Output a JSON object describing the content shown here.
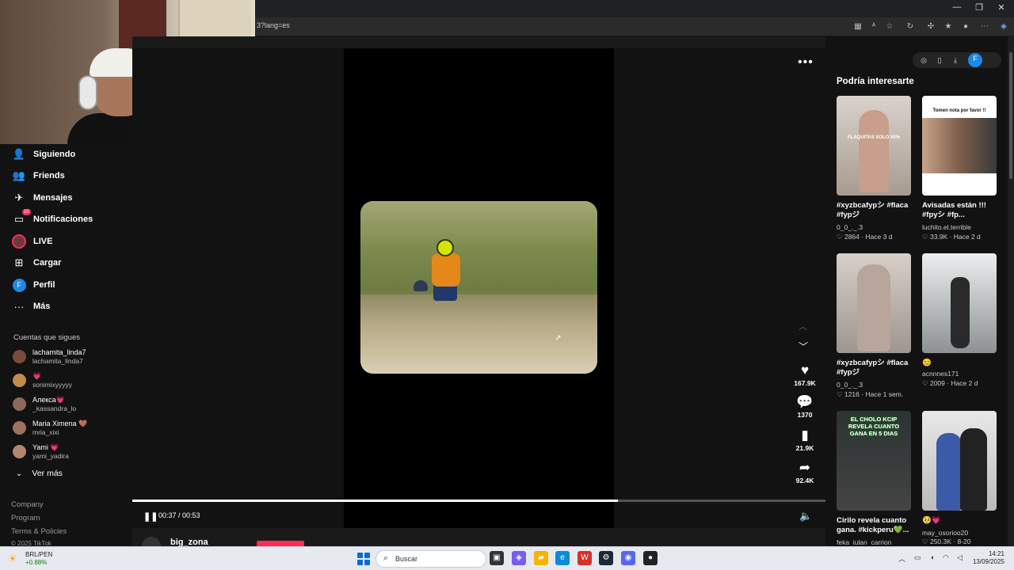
{
  "browser": {
    "url": "3?lang=es",
    "window_controls": [
      "—",
      "❐",
      "✕"
    ]
  },
  "sidebar": {
    "items": [
      {
        "label": "Siguiendo",
        "icon": "following-icon"
      },
      {
        "label": "Friends",
        "icon": "friends-icon"
      },
      {
        "label": "Mensajes",
        "icon": "messages-icon"
      },
      {
        "label": "Notificaciones",
        "icon": "notifications-icon",
        "badge": "10"
      },
      {
        "label": "LIVE",
        "icon": "live-icon"
      },
      {
        "label": "Cargar",
        "icon": "upload-icon"
      },
      {
        "label": "Perfil",
        "icon": "profile-icon",
        "avatar_letter": "F"
      },
      {
        "label": "Más",
        "icon": "more-icon"
      }
    ],
    "following_heading": "Cuentas que sigues",
    "accounts": [
      {
        "name": "lachamita_linda7",
        "handle": "lachamita_linda7",
        "color": "#7a4b3a"
      },
      {
        "name": "💗",
        "handle": "sonimixyyyyy",
        "color": "#c28b4b"
      },
      {
        "name": "Алекса💗",
        "handle": "_kassandra_lo",
        "color": "#8a6a5a"
      },
      {
        "name": "Maria Ximena 🤎",
        "handle": "mria_xixi",
        "color": "#a07060"
      },
      {
        "name": "Yami 💗",
        "handle": "yami_yadira",
        "color": "#b08870"
      }
    ],
    "see_more": "Ver más",
    "footer_links": [
      "Company",
      "Program",
      "Terms & Policies",
      "© 2025 TikTok"
    ]
  },
  "video": {
    "more": "•••",
    "likes": "167.9K",
    "comments": "1370",
    "saves": "21.9K",
    "shares": "92.4K",
    "time": "00:37 / 00:53",
    "progress": 0.7,
    "author": "big_zona"
  },
  "panel": {
    "title": "Podría interesarte",
    "cards": [
      {
        "thumb_text": "FLAQUITAS SOLO 50%",
        "caption": "#xyzbcafypシ #flaca #fypジ",
        "author": "0_0_._.3",
        "stats": "♡ 2864 · Hace 3 d"
      },
      {
        "thumb_text": "Tomen nota por favor !!",
        "caption": "Avisadas están !!! #fpyシ #fp...",
        "author": "luchito.el.terrible",
        "stats": "♡ 33.9K · Hace 2 d"
      },
      {
        "thumb_text": "",
        "caption": "#xyzbcafypシ #flaca #fypジ",
        "author": "0_0_._.3",
        "stats": "♡ 1216 · Hace 1 sem."
      },
      {
        "thumb_text": "",
        "caption": "😊",
        "author": "acnnnes171",
        "stats": "♡ 2009 · Hace 2 d"
      },
      {
        "thumb_text": "EL CHOLO KCIP REVELA CUANTO GANA EN 5 DIAS",
        "caption": "Cirilo revela cuanto gana. #kickperu💚...",
        "author": "feka_iulan_carrion",
        "stats": ""
      },
      {
        "thumb_text": "",
        "caption": "🥺💗",
        "author": "may_osorioo20",
        "stats": "♡ 250.3K · 8-20"
      }
    ]
  },
  "taskbar": {
    "ticker_symbol": "BRL/PEN",
    "ticker_change": "+0.88%",
    "search_placeholder": "Buscar",
    "time": "14:21",
    "date": "13/09/2025"
  },
  "colors": {
    "accent": "#fe2c55",
    "bg": "#121212",
    "taskbar": "#e6eaf0"
  }
}
